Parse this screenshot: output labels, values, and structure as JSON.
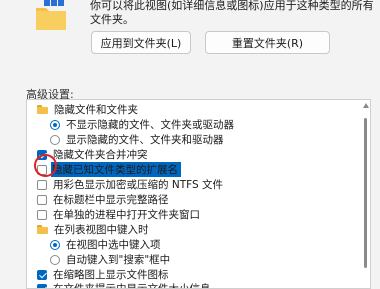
{
  "header": {
    "line1": "你可以将此视图(如详细信息或图标)应用于这种类型的所有",
    "line2": "文件夹。"
  },
  "buttons": {
    "apply": "应用到文件夹(L)",
    "reset": "重置文件夹(R)"
  },
  "advanced_label": "高级设置:",
  "tree": [
    {
      "type": "folder",
      "label": "隐藏文件和文件夹"
    },
    {
      "type": "radio",
      "checked": true,
      "label": "不显示隐藏的文件、文件夹或驱动器"
    },
    {
      "type": "radio",
      "checked": false,
      "label": "显示隐藏的文件、文件夹和驱动器"
    },
    {
      "type": "checkbox",
      "checked": true,
      "label": "隐藏文件夹合并冲突"
    },
    {
      "type": "checkbox",
      "checked": false,
      "label": "隐藏已知文件类型的扩展名",
      "selected": true
    },
    {
      "type": "checkbox",
      "checked": false,
      "label": "用彩色显示加密或压缩的 NTFS 文件"
    },
    {
      "type": "checkbox",
      "checked": false,
      "label": "在标题栏中显示完整路径"
    },
    {
      "type": "checkbox",
      "checked": false,
      "label": "在单独的进程中打开文件夹窗口"
    },
    {
      "type": "folder",
      "label": "在列表视图中键入时"
    },
    {
      "type": "radio",
      "checked": true,
      "label": "在视图中选中键入项"
    },
    {
      "type": "radio",
      "checked": false,
      "label": "自动键入到\"搜索\"框中"
    },
    {
      "type": "checkbox",
      "checked": true,
      "label": "在缩略图上显示文件图标"
    },
    {
      "type": "checkbox",
      "checked": true,
      "label": "在文件夹提示中显示文件大小信息"
    }
  ],
  "colors": {
    "accent": "#0067c0",
    "annotation": "#e02020"
  }
}
